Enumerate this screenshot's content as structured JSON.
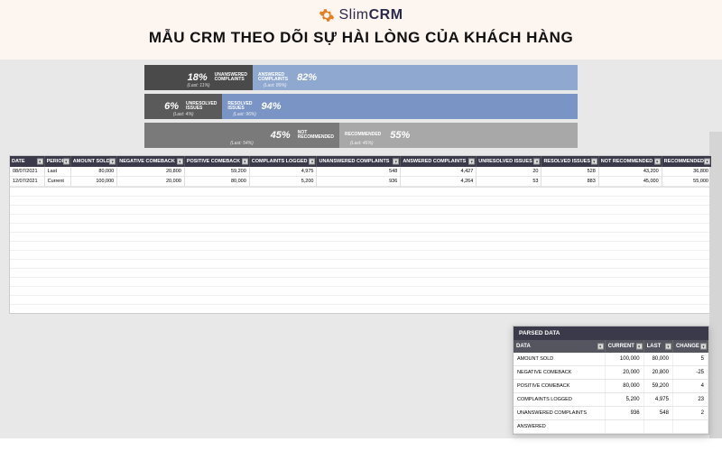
{
  "brand": {
    "name_light": "Slim",
    "name_bold": "CRM"
  },
  "title": "MẪU CRM THEO DÕI SỰ HÀI LÒNG CỦA KHÁCH HÀNG",
  "bars": [
    {
      "left_pct": "18%",
      "left_label": "UNANSWERED COMPLAINTS",
      "left_last": "(Last: 11%)",
      "left_w": 25,
      "right_pct": "82%",
      "right_label": "ANSWERED COMPLAINTS",
      "right_last": "(Last: 89%)",
      "right_w": 75,
      "cls": "bar1"
    },
    {
      "left_pct": "6%",
      "left_label": "UNRESOLVED ISSUES",
      "left_last": "(Last: 4%)",
      "left_w": 18,
      "right_pct": "94%",
      "right_label": "RESOLVED ISSUES",
      "right_last": "(Last: 96%)",
      "right_w": 82,
      "cls": "bar2"
    },
    {
      "left_pct": "45%",
      "left_label": "NOT RECOMMENDED",
      "left_last": "(Last: 54%)",
      "left_w": 45,
      "right_pct": "55%",
      "right_label": "RECOMMENDED",
      "right_last": "(Last: 46%)",
      "right_w": 55,
      "cls": "bar3"
    }
  ],
  "main_headers": [
    "DATE",
    "PERIOD",
    "AMOUNT SOLD",
    "NEGATIVE COMEBACK",
    "POSITIVE COMEBACK",
    "COMPLAINTS LOGGED",
    "UNANSWERED COMPLAINTS",
    "ANSWERED COMPLAINTS",
    "UNRESOLVED ISSUES",
    "RESOLVED ISSUES",
    "NOT RECOMMENDED",
    "RECOMMENDED"
  ],
  "main_rows": [
    [
      "08/07/2021",
      "Last",
      "80,000",
      "20,800",
      "59,200",
      "4,975",
      "548",
      "4,427",
      "20",
      "528",
      "43,200",
      "36,800"
    ],
    [
      "12/07/2021",
      "Current",
      "100,000",
      "20,000",
      "80,000",
      "5,200",
      "936",
      "4,264",
      "53",
      "883",
      "45,000",
      "55,000"
    ]
  ],
  "parsed": {
    "title": "PARSED DATA",
    "headers": [
      "DATA",
      "CURRENT",
      "LAST",
      "CHANGE"
    ],
    "rows": [
      [
        "AMOUNT SOLD",
        "100,000",
        "80,000",
        "5"
      ],
      [
        "NEGATIVE COMEBACK",
        "20,000",
        "20,800",
        "-25"
      ],
      [
        "POSITIVE COMEBACK",
        "80,000",
        "59,200",
        "4"
      ],
      [
        "COMPLAINTS LOGGED",
        "5,200",
        "4,975",
        "23"
      ],
      [
        "UNANSWERED COMPLAINTS",
        "936",
        "548",
        "2"
      ],
      [
        "ANSWERED",
        "",
        "",
        ""
      ]
    ]
  },
  "chart_data": [
    {
      "type": "bar",
      "title": "Complaints Answered",
      "series": [
        {
          "name": "UNANSWERED COMPLAINTS",
          "values": [
            18
          ],
          "last": 11
        },
        {
          "name": "ANSWERED COMPLAINTS",
          "values": [
            82
          ],
          "last": 89
        }
      ],
      "ylim": [
        0,
        100
      ]
    },
    {
      "type": "bar",
      "title": "Issues Resolved",
      "series": [
        {
          "name": "UNRESOLVED ISSUES",
          "values": [
            6
          ],
          "last": 4
        },
        {
          "name": "RESOLVED ISSUES",
          "values": [
            94
          ],
          "last": 96
        }
      ],
      "ylim": [
        0,
        100
      ]
    },
    {
      "type": "bar",
      "title": "Recommendation",
      "series": [
        {
          "name": "NOT RECOMMENDED",
          "values": [
            45
          ],
          "last": 54
        },
        {
          "name": "RECOMMENDED",
          "values": [
            55
          ],
          "last": 46
        }
      ],
      "ylim": [
        0,
        100
      ]
    }
  ]
}
